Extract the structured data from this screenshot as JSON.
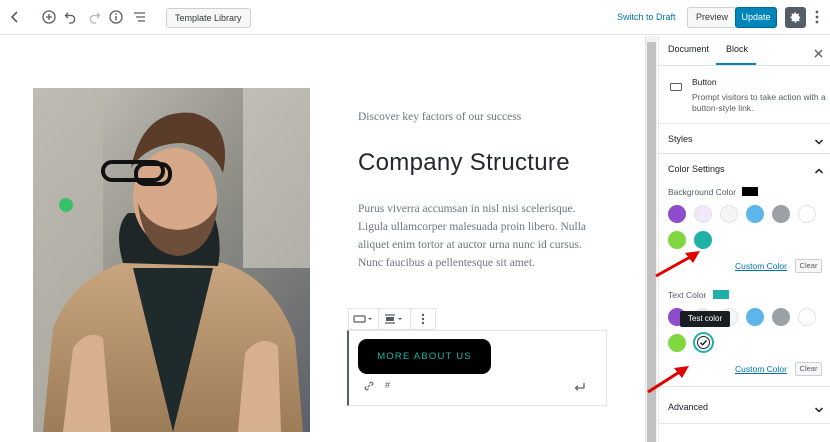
{
  "toolbar": {
    "template_library": "Template Library",
    "switch_to_draft": "Switch to Draft",
    "preview": "Preview",
    "update": "Update",
    "icons": [
      "back-icon",
      "add-block-icon",
      "undo-icon",
      "redo-icon",
      "info-icon",
      "outline-icon",
      "gear-icon"
    ]
  },
  "content": {
    "subtitle": "Discover key factors of our success",
    "heading": "Company Structure",
    "paragraph": "Purus viverra accumsan in nisl nisi scelerisque. Ligula ullamcorper malesuada proin libero. Nulla aliquet enim tortor at auctor urna nunc id cursus. Nunc faucibus a pellentesque sit amet.",
    "button_label": "MORE ABOUT US",
    "link_value": "#"
  },
  "sidebar": {
    "tabs": [
      "Document",
      "Block"
    ],
    "active_tab": "Block",
    "block_name": "Button",
    "block_desc": "Prompt visitors to take action with a button-style link.",
    "styles": "Styles",
    "color_settings": "Color Settings",
    "background_color_label": "Background Color",
    "background_color_value": "#000000",
    "text_color_label": "Text Color",
    "text_color_value": "#1fb0a8",
    "custom_color": "Custom Color",
    "clear": "Clear",
    "tooltip": "Test color",
    "advanced": "Advanced",
    "palette": [
      "#8f4dce",
      "#f1e8fa",
      "#f3f5f6",
      "#5cb6e9",
      "#9ca1a6",
      "#ffffff",
      "#81d742",
      "#1fb0a8"
    ]
  },
  "colors": {
    "accent": "#0085ba",
    "annotation_arrow": "#e00000"
  }
}
